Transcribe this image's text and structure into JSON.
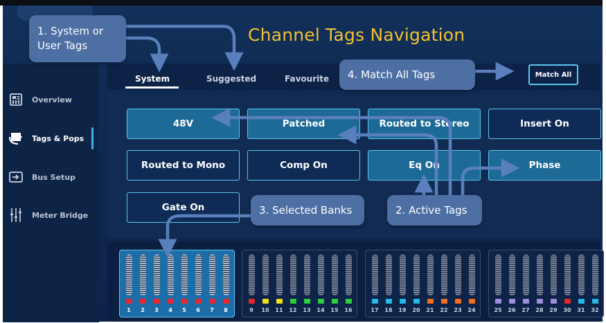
{
  "title": "Channel Tags Navigation",
  "sidebar": {
    "items": [
      {
        "label": "Overview",
        "icon": "overview-icon",
        "active": false
      },
      {
        "label": "Tags & Pops",
        "icon": "tag-icon",
        "active": true
      },
      {
        "label": "Bus Setup",
        "icon": "bus-icon",
        "active": false
      },
      {
        "label": "Meter Bridge",
        "icon": "meter-icon",
        "active": false
      }
    ]
  },
  "tabs": [
    {
      "label": "System",
      "active": true
    },
    {
      "label": "Suggested",
      "active": false
    },
    {
      "label": "Favourite",
      "active": false
    }
  ],
  "match_all_label": "Match All",
  "tags": [
    {
      "label": "48V",
      "active": true
    },
    {
      "label": "Patched",
      "active": true
    },
    {
      "label": "Routed to Stereo",
      "active": true
    },
    {
      "label": "Insert On",
      "active": false
    },
    {
      "label": "Routed to Mono",
      "active": false
    },
    {
      "label": "Comp On",
      "active": false
    },
    {
      "label": "Eq On",
      "active": true
    },
    {
      "label": "Phase",
      "active": true
    },
    {
      "label": "Gate On",
      "active": false
    }
  ],
  "callouts": {
    "system_or_user": "1. System or User Tags",
    "active_tags": "2. Active Tags",
    "selected_banks": "3. Selected Banks",
    "match_all_tags": "4. Match All Tags"
  },
  "banks": [
    {
      "selected": true,
      "channels": [
        {
          "num": "1",
          "color": "#e8282c"
        },
        {
          "num": "2",
          "color": "#e8282c"
        },
        {
          "num": "3",
          "color": "#e8282c"
        },
        {
          "num": "4",
          "color": "#e8282c"
        },
        {
          "num": "5",
          "color": "#e8282c"
        },
        {
          "num": "6",
          "color": "#e8282c"
        },
        {
          "num": "7",
          "color": "#e8282c"
        },
        {
          "num": "8",
          "color": "#e8282c"
        }
      ]
    },
    {
      "selected": false,
      "channels": [
        {
          "num": "9",
          "color": "#e8282c"
        },
        {
          "num": "10",
          "color": "#f0e020"
        },
        {
          "num": "11",
          "color": "#f0e020"
        },
        {
          "num": "12",
          "color": "#2ecc40"
        },
        {
          "num": "13",
          "color": "#2ecc40"
        },
        {
          "num": "14",
          "color": "#2ecc40"
        },
        {
          "num": "15",
          "color": "#2ecc40"
        },
        {
          "num": "16",
          "color": "#2ecc40"
        }
      ]
    },
    {
      "selected": false,
      "channels": [
        {
          "num": "17",
          "color": "#28b8e8"
        },
        {
          "num": "18",
          "color": "#28b8e8"
        },
        {
          "num": "19",
          "color": "#28b8e8"
        },
        {
          "num": "20",
          "color": "#28b8e8"
        },
        {
          "num": "21",
          "color": "#f07020"
        },
        {
          "num": "22",
          "color": "#f07020"
        },
        {
          "num": "23",
          "color": "#f07020"
        },
        {
          "num": "24",
          "color": "#f07020"
        }
      ]
    },
    {
      "selected": false,
      "channels": [
        {
          "num": "25",
          "color": "#a08ee0"
        },
        {
          "num": "26",
          "color": "#a08ee0"
        },
        {
          "num": "27",
          "color": "#a08ee0"
        },
        {
          "num": "28",
          "color": "#a08ee0"
        },
        {
          "num": "29",
          "color": "#a08ee0"
        },
        {
          "num": "30",
          "color": "#e8282c"
        },
        {
          "num": "31",
          "color": "#28b8e8"
        },
        {
          "num": "32",
          "color": "#28b8e8"
        }
      ]
    }
  ]
}
